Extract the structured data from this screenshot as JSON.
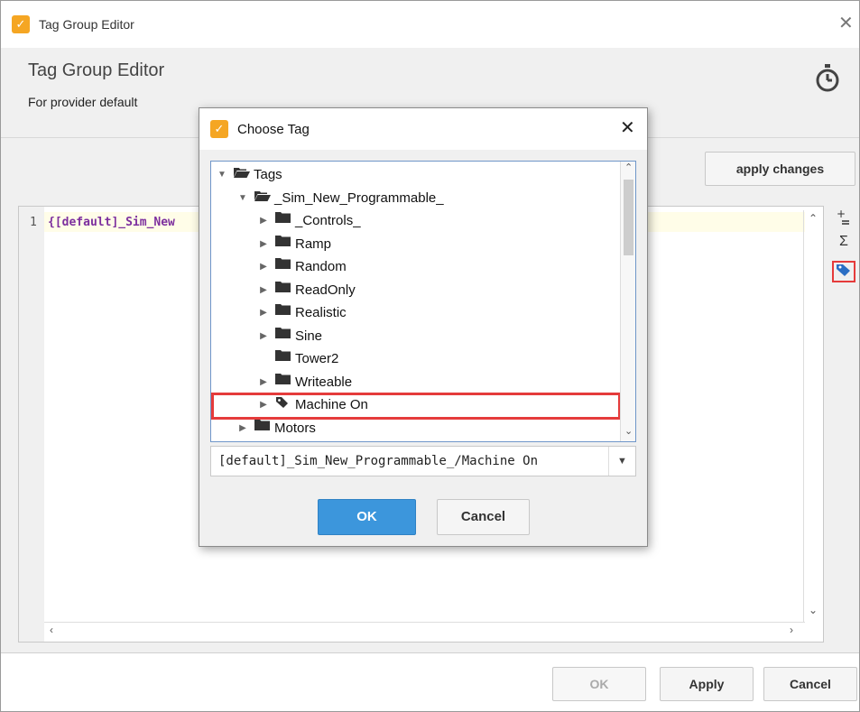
{
  "window": {
    "title": "Tag Group Editor",
    "header_title": "Tag Group Editor",
    "header_subtitle": "For provider default",
    "apply_changes_label": "apply changes",
    "expression_line_number": "1",
    "expression_text": "{[default]_Sim_New",
    "footer": {
      "ok_label": "OK",
      "apply_label": "Apply",
      "cancel_label": "Cancel"
    },
    "side_tools": [
      "add-property-icon",
      "sigma-icon",
      "tag-icon"
    ]
  },
  "dialog": {
    "title": "Choose Tag",
    "tree": [
      {
        "label": "Tags",
        "level": 0,
        "type": "folder-open",
        "expanded": true
      },
      {
        "label": "_Sim_New_Programmable_",
        "level": 1,
        "type": "folder-open",
        "expanded": true
      },
      {
        "label": "_Controls_",
        "level": 2,
        "type": "folder",
        "expandable": true
      },
      {
        "label": "Ramp",
        "level": 2,
        "type": "folder",
        "expandable": true
      },
      {
        "label": "Random",
        "level": 2,
        "type": "folder",
        "expandable": true
      },
      {
        "label": "ReadOnly",
        "level": 2,
        "type": "folder",
        "expandable": true
      },
      {
        "label": "Realistic",
        "level": 2,
        "type": "folder",
        "expandable": true
      },
      {
        "label": "Sine",
        "level": 2,
        "type": "folder",
        "expandable": true
      },
      {
        "label": "Tower2",
        "level": 2,
        "type": "folder",
        "expandable": false
      },
      {
        "label": "Writeable",
        "level": 2,
        "type": "folder",
        "expandable": true
      },
      {
        "label": "Machine On",
        "level": 2,
        "type": "tag",
        "expandable": true,
        "highlighted": true
      },
      {
        "label": "Motors",
        "level": 1,
        "type": "folder",
        "expandable": true
      }
    ],
    "selected_path": "[default]_Sim_New_Programmable_/Machine On",
    "ok_label": "OK",
    "cancel_label": "Cancel"
  },
  "colors": {
    "accent_blue": "#3c96dc",
    "highlight_red": "#e53b3b",
    "app_icon_orange": "#f5a623",
    "code_purple": "#7d2f9e"
  }
}
